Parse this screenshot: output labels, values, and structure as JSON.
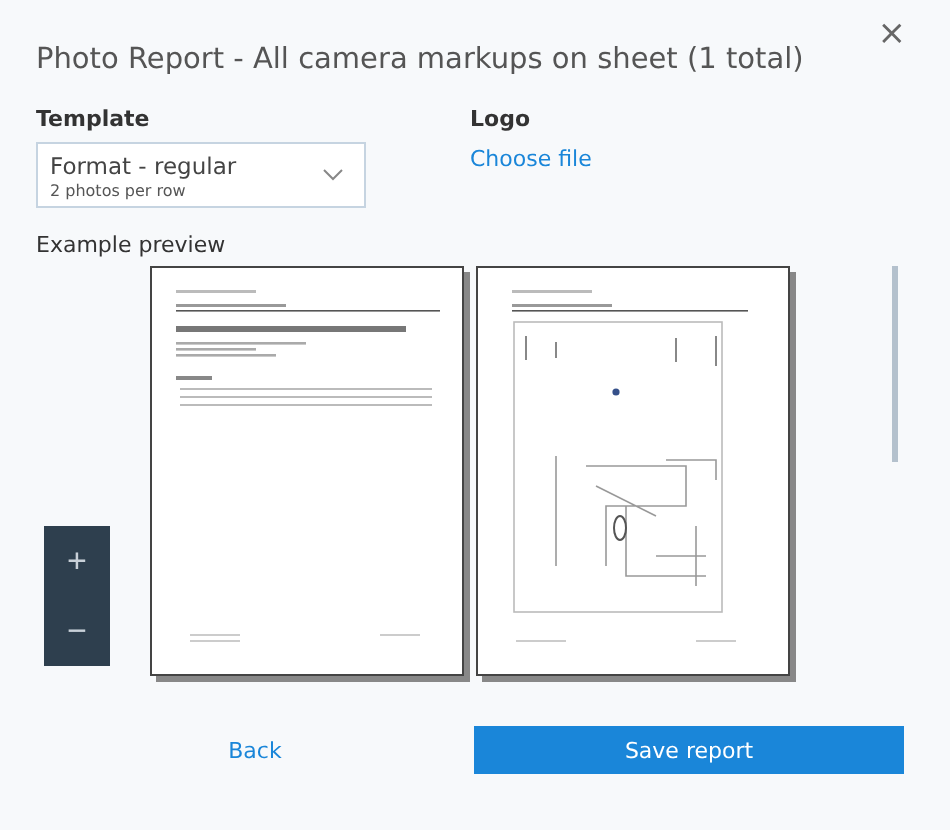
{
  "dialog": {
    "title": "Photo Report - All camera markups on sheet (1 total)",
    "close": "×"
  },
  "template": {
    "label": "Template",
    "value": "Format - regular",
    "detail": "2 photos per row"
  },
  "logo": {
    "label": "Logo",
    "link": "Choose file"
  },
  "preview": {
    "label": "Example preview",
    "zoom": [
      "+",
      "−"
    ],
    "pages": [
      {
        "kind": "contents"
      },
      {
        "kind": "plan"
      }
    ]
  },
  "buttons": {
    "back": "Back",
    "save": "Save report"
  }
}
